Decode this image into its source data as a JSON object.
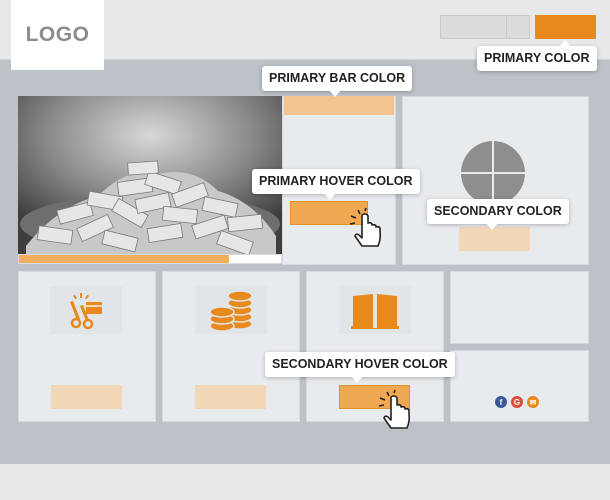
{
  "header": {
    "logo_text": "LOGO"
  },
  "colors": {
    "primary": "#e8891d",
    "primary_bar": "#f3c48f",
    "primary_hover": "#f0a853",
    "secondary": "#f2d6b8",
    "secondary_hover": "#f0a853",
    "background": "#bcc2c8",
    "card": "#e8ebee"
  },
  "tooltips": {
    "primary_color": "PRIMARY COLOR",
    "primary_bar_color": "PRIMARY BAR COLOR",
    "primary_hover_color": "PRIMARY HOVER COLOR",
    "secondary_color": "SECONDARY COLOR",
    "secondary_hover_color": "SECONDARY HOVER COLOR"
  },
  "hero": {
    "image": "money-pile-image",
    "progress": 0.8
  },
  "icons": [
    "pie-chart-icon",
    "coupon-scissors-icon",
    "coin-stack-icon",
    "book-icon"
  ],
  "social": [
    {
      "name": "facebook-icon",
      "glyph": "f",
      "color": "#3b5998"
    },
    {
      "name": "google-icon",
      "glyph": "G",
      "color": "#dd4b39"
    },
    {
      "name": "email-icon",
      "glyph": "✉",
      "color": "#e8891d"
    }
  ]
}
